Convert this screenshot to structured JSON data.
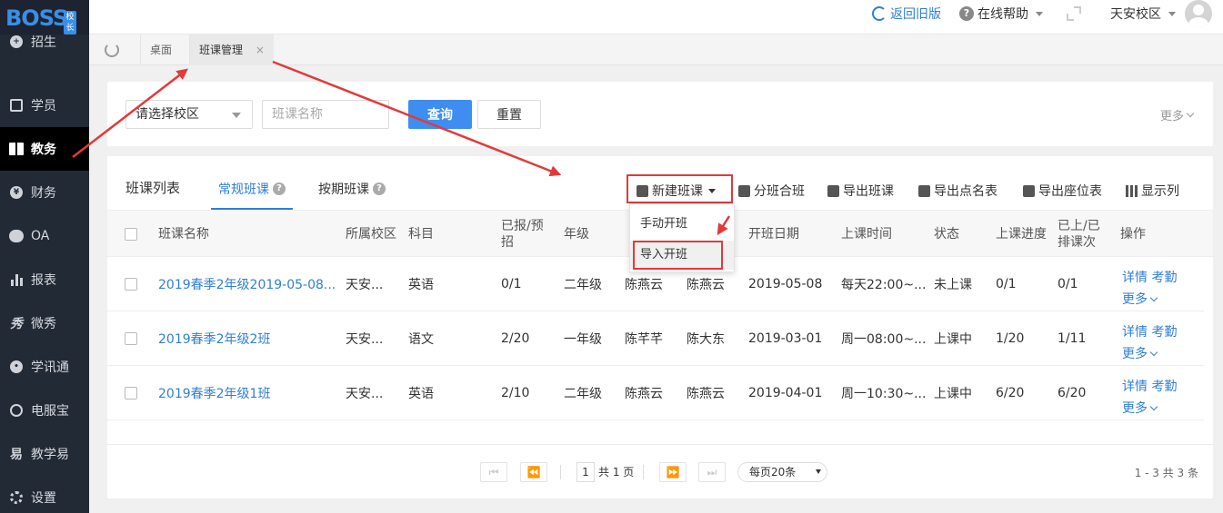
{
  "logo": {
    "text": "BOSS",
    "badge": "校长"
  },
  "topbar": {
    "back_label": "返回旧版",
    "help_label": "在线帮助",
    "campus_label": "天安校区"
  },
  "sidebar": {
    "items": [
      {
        "label": "招生",
        "icon": "person-add-icon"
      },
      {
        "label": "学员",
        "icon": "student-card-icon"
      },
      {
        "label": "教务",
        "icon": "book-icon"
      },
      {
        "label": "财务",
        "icon": "yen-icon"
      },
      {
        "label": "OA",
        "icon": "toggle-icon"
      },
      {
        "label": "报表",
        "icon": "bar-chart-icon"
      },
      {
        "label": "微秀",
        "icon": "show-icon"
      },
      {
        "label": "学讯通",
        "icon": "location-pin-icon"
      },
      {
        "label": "电服宝",
        "icon": "phone-service-icon"
      },
      {
        "label": "教学易",
        "icon": "teach-icon"
      },
      {
        "label": "设置",
        "icon": "gear-icon"
      }
    ]
  },
  "tabs": [
    {
      "label": "桌面"
    },
    {
      "label": "班课管理",
      "close": "×"
    }
  ],
  "filter": {
    "campus_placeholder": "请选择校区",
    "name_placeholder": "班课名称",
    "query_label": "查询",
    "reset_label": "重置",
    "more_label": "更多"
  },
  "list": {
    "title": "班课列表",
    "subtabs": [
      {
        "label": "常规班课",
        "help": "?"
      },
      {
        "label": "按期班课",
        "help": "?"
      }
    ],
    "toolbar": [
      {
        "label": "新建班课",
        "icon": "new-class-icon"
      },
      {
        "label": "分班合班",
        "icon": "split-merge-icon"
      },
      {
        "label": "导出班课",
        "icon": "export-icon"
      },
      {
        "label": "导出点名表",
        "icon": "roll-call-icon"
      },
      {
        "label": "导出座位表",
        "icon": "seat-icon"
      },
      {
        "label": "显示列",
        "icon": "columns-icon"
      }
    ],
    "dropdown": [
      {
        "label": "手动开班"
      },
      {
        "label": "导入开班"
      }
    ],
    "columns": [
      "班课名称",
      "所属校区",
      "科目",
      "已报/预招",
      "年级",
      "",
      "",
      "开班日期",
      "上课时间",
      "状态",
      "上课进度",
      "已上/已排课次",
      "操作"
    ],
    "rows": [
      {
        "name": "2019春季2年级2019-05-08...",
        "campus": "天安...",
        "subject": "英语",
        "enroll": "0/1",
        "grade": "二年级",
        "teacher1": "陈燕云",
        "teacher2": "陈燕云",
        "start": "2019-05-08",
        "time": "每天22:00~...",
        "status": "未上课",
        "progress": "0/1",
        "sessions": "0/1"
      },
      {
        "name": "2019春季2年级2班",
        "campus": "天安...",
        "subject": "语文",
        "enroll": "2/20",
        "grade": "一年级",
        "teacher1": "陈芊芊",
        "teacher2": "陈大东",
        "start": "2019-03-01",
        "time": "周一08:00~...",
        "status": "上课中",
        "progress": "1/20",
        "sessions": "1/11"
      },
      {
        "name": "2019春季2年级1班",
        "campus": "天安...",
        "subject": "英语",
        "enroll": "2/10",
        "grade": "二年级",
        "teacher1": "陈燕云",
        "teacher2": "陈燕云",
        "start": "2019-04-01",
        "time": "周一10:30~...",
        "status": "上课中",
        "progress": "6/20",
        "sessions": "6/20"
      }
    ],
    "ops": {
      "detail": "详情",
      "attendance": "考勤",
      "more": "更多"
    }
  },
  "pager": {
    "page": "1",
    "total_pages": "共 1 页",
    "page_size": "每页20条",
    "summary": "1 - 3   共 3 条"
  },
  "colors": {
    "accent": "#3d8ef0",
    "link": "#2f7fd8",
    "sidebar": "#222a36",
    "annotation": "#e23a3a"
  }
}
